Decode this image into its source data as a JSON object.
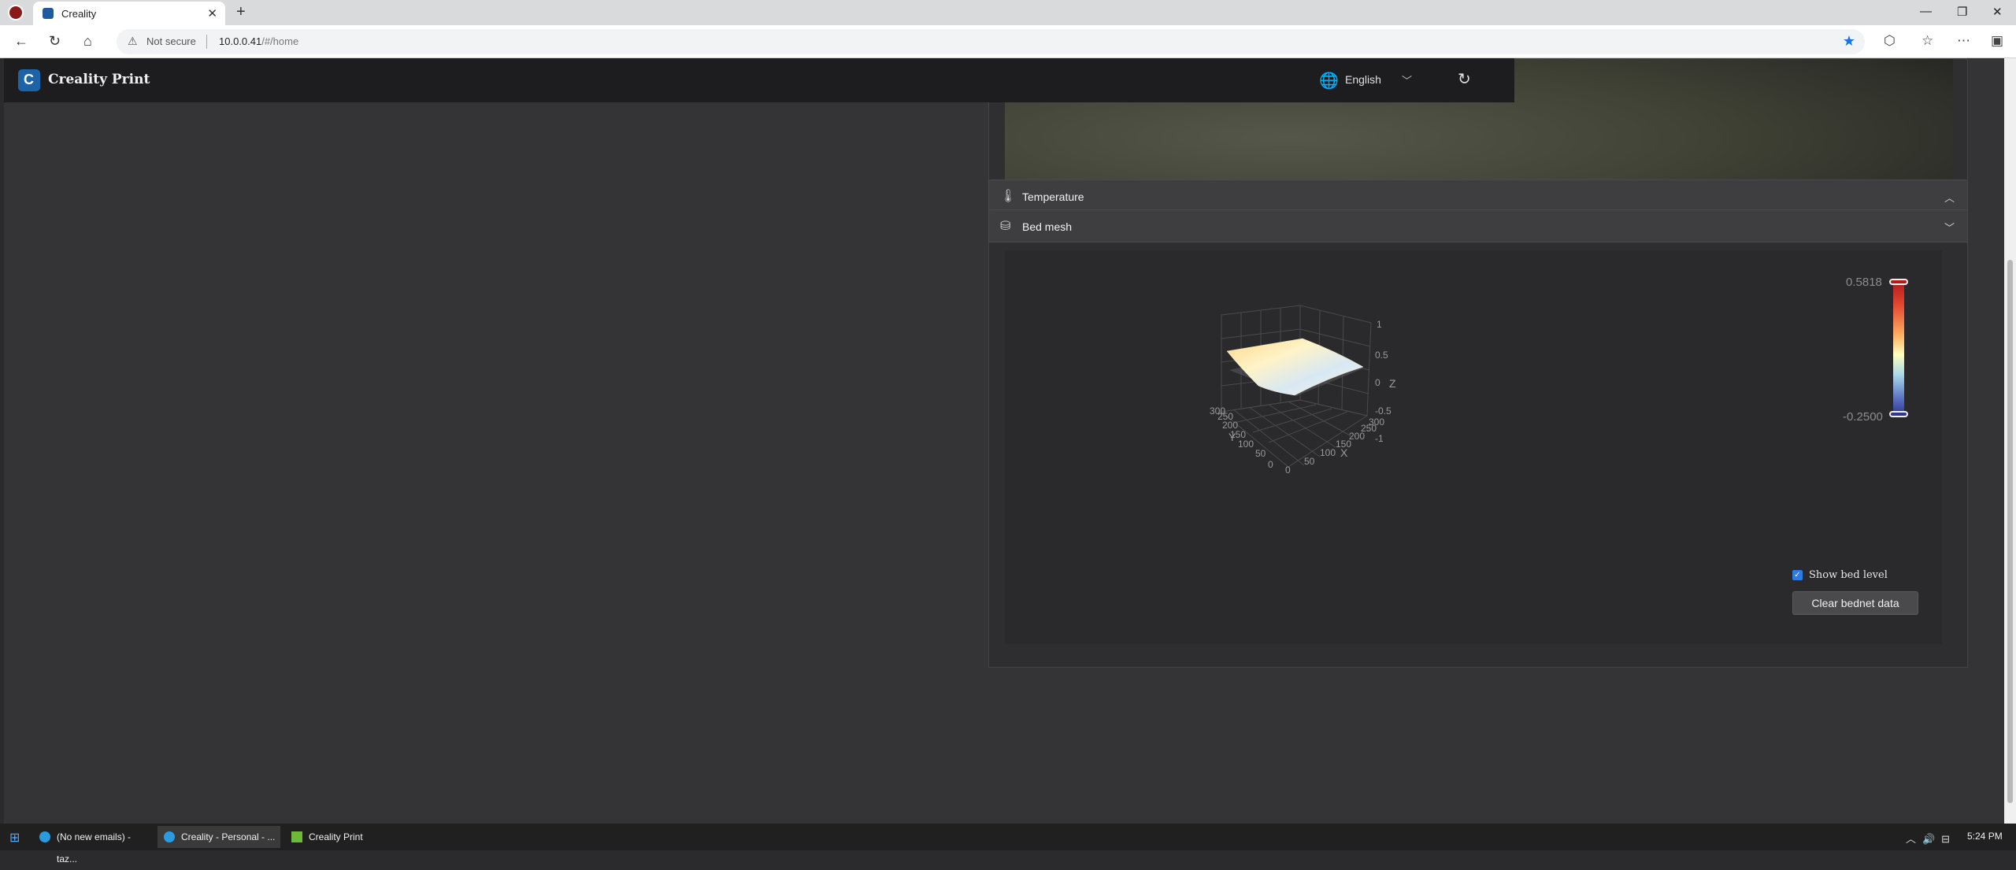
{
  "browser": {
    "tab_title": "Creality",
    "new_tab": "+",
    "not_secure": "Not secure",
    "url_host": "10.0.0.41",
    "url_path": "/#/home",
    "window_controls": [
      "—",
      "❐",
      "✕"
    ]
  },
  "header": {
    "app_name": "Creality Print",
    "logo_glyph": "C",
    "language": "English"
  },
  "sections": {
    "temperature": {
      "title": "Temperature",
      "icon": "thermometer-icon",
      "chevron": "︿"
    },
    "bed_mesh": {
      "title": "Bed mesh",
      "icon": "bed-mesh-icon",
      "chevron": "﹀"
    }
  },
  "bed_mesh": {
    "scale_max": "0.5818",
    "scale_min": "-0.2500",
    "show_bed_level_label": "Show bed level",
    "show_bed_level_checked": true,
    "clear_button": "Clear bednet data",
    "z_axis_label": "Z",
    "x_axis_label": "X",
    "y_axis_label": "Y",
    "z_ticks": [
      "1",
      "0.5",
      "0",
      "-0.5",
      "-1"
    ],
    "x_ticks": [
      "0",
      "50",
      "100",
      "150",
      "200",
      "250",
      "300"
    ],
    "y_ticks": [
      "0",
      "50",
      "100",
      "150",
      "200",
      "250",
      "300"
    ],
    "colorscale": [
      "#b31b1b",
      "#e34a33",
      "#fdae61",
      "#ffffbf",
      "#abd9e9",
      "#5b74c2",
      "#313695"
    ]
  },
  "taskbar": {
    "items": [
      "(No new emails) - taz...",
      "Creality - Personal - ...",
      "Creality Print"
    ],
    "clock": "5:24 PM"
  }
}
